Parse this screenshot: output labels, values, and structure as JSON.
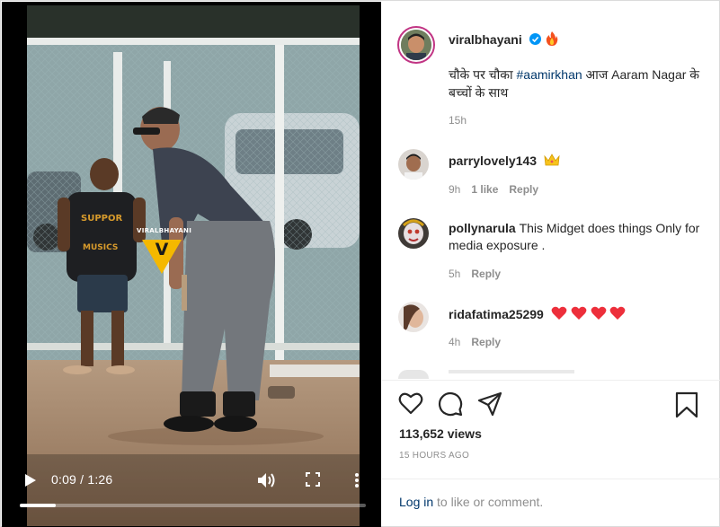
{
  "video": {
    "watermark": "VIRALBHAYANI",
    "watermark_logo": "V",
    "current_time": "0:09",
    "duration": "1:26",
    "time_separator": " / ",
    "progress": 0.105,
    "icons": {
      "play": "play-icon",
      "volume": "volume-icon",
      "fullscreen": "fullscreen-icon",
      "more": "more-vertical-icon"
    }
  },
  "post": {
    "author": "viralbhayani",
    "verified_icon": "verified-badge-icon",
    "author_emoji_icon": "fire-icon",
    "caption_before": "चौके पर चौका ",
    "caption_hashtag": "#aamirkhan",
    "caption_after": " आज Aaram Nagar के बच्चों के साथ",
    "caption_time": "15h"
  },
  "comments": [
    {
      "username": "parrylovely143",
      "text": "",
      "emoji_icon": "crown-icon",
      "age": "9h",
      "likes": "1 like",
      "reply": "Reply"
    },
    {
      "username": "pollynarula",
      "text": "This Midget does things Only for media exposure .",
      "age": "5h",
      "reply": "Reply"
    },
    {
      "username": "ridafatima25299",
      "text": "",
      "emoji_icon": "heart-emoji-icon",
      "emoji_count": 4,
      "age": "4h",
      "reply": "Reply"
    }
  ],
  "actions": {
    "icons": [
      "heart-outline-icon",
      "comment-icon",
      "send-icon",
      "bookmark-icon"
    ],
    "views": "113,652 views",
    "posted": "15 HOURS AGO"
  },
  "login": {
    "link": "Log in",
    "rest": " to like or comment."
  },
  "colors": {
    "link_blue": "#00376b",
    "verified_blue": "#0095f6",
    "muted_gray": "#8e8e8e",
    "heart_red": "#ed2f3b",
    "watermark_yellow": "#f5b800",
    "story_ring": "#c13584"
  }
}
